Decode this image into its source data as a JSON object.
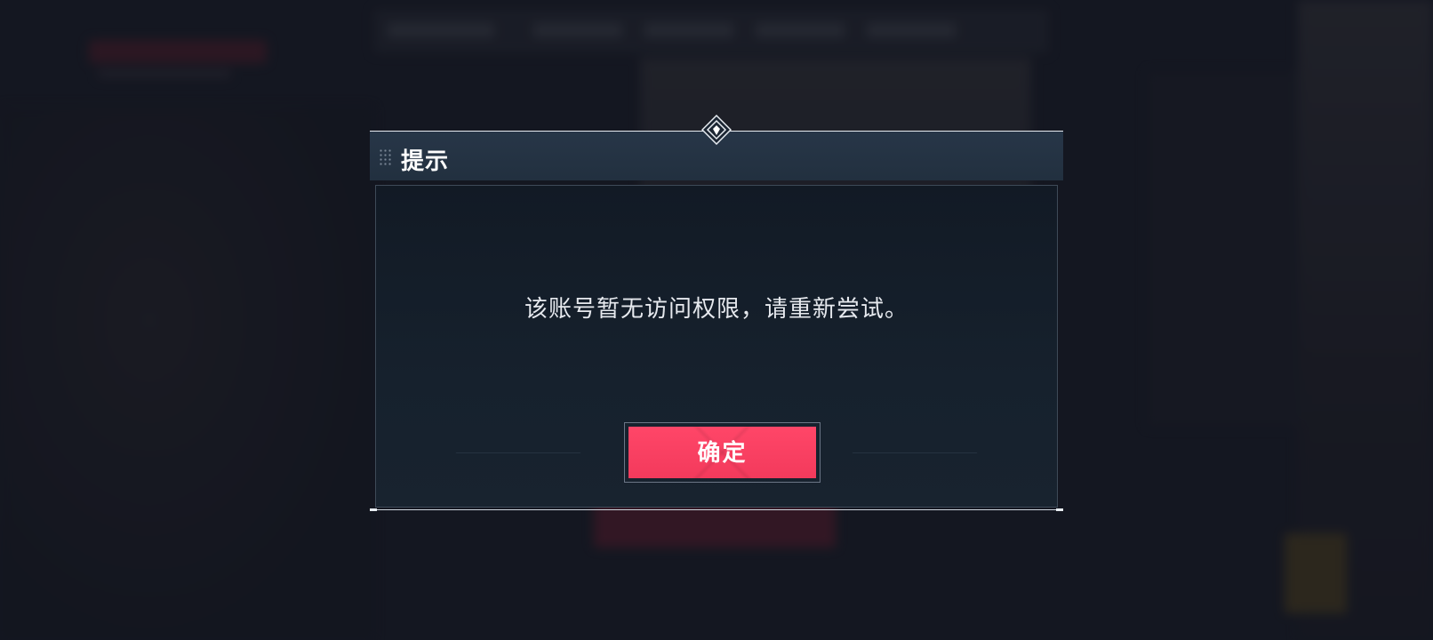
{
  "dialog": {
    "title": "提示",
    "message": "该账号暂无访问权限，请重新尝试。",
    "confirm_label": "确定"
  },
  "colors": {
    "accent": "#ff4668",
    "header_bg": "#273648",
    "panel_bg": "#121a25",
    "text": "#e6e9ee"
  },
  "icons": [
    "drag-grip-icon",
    "diamond-emblem-icon"
  ]
}
